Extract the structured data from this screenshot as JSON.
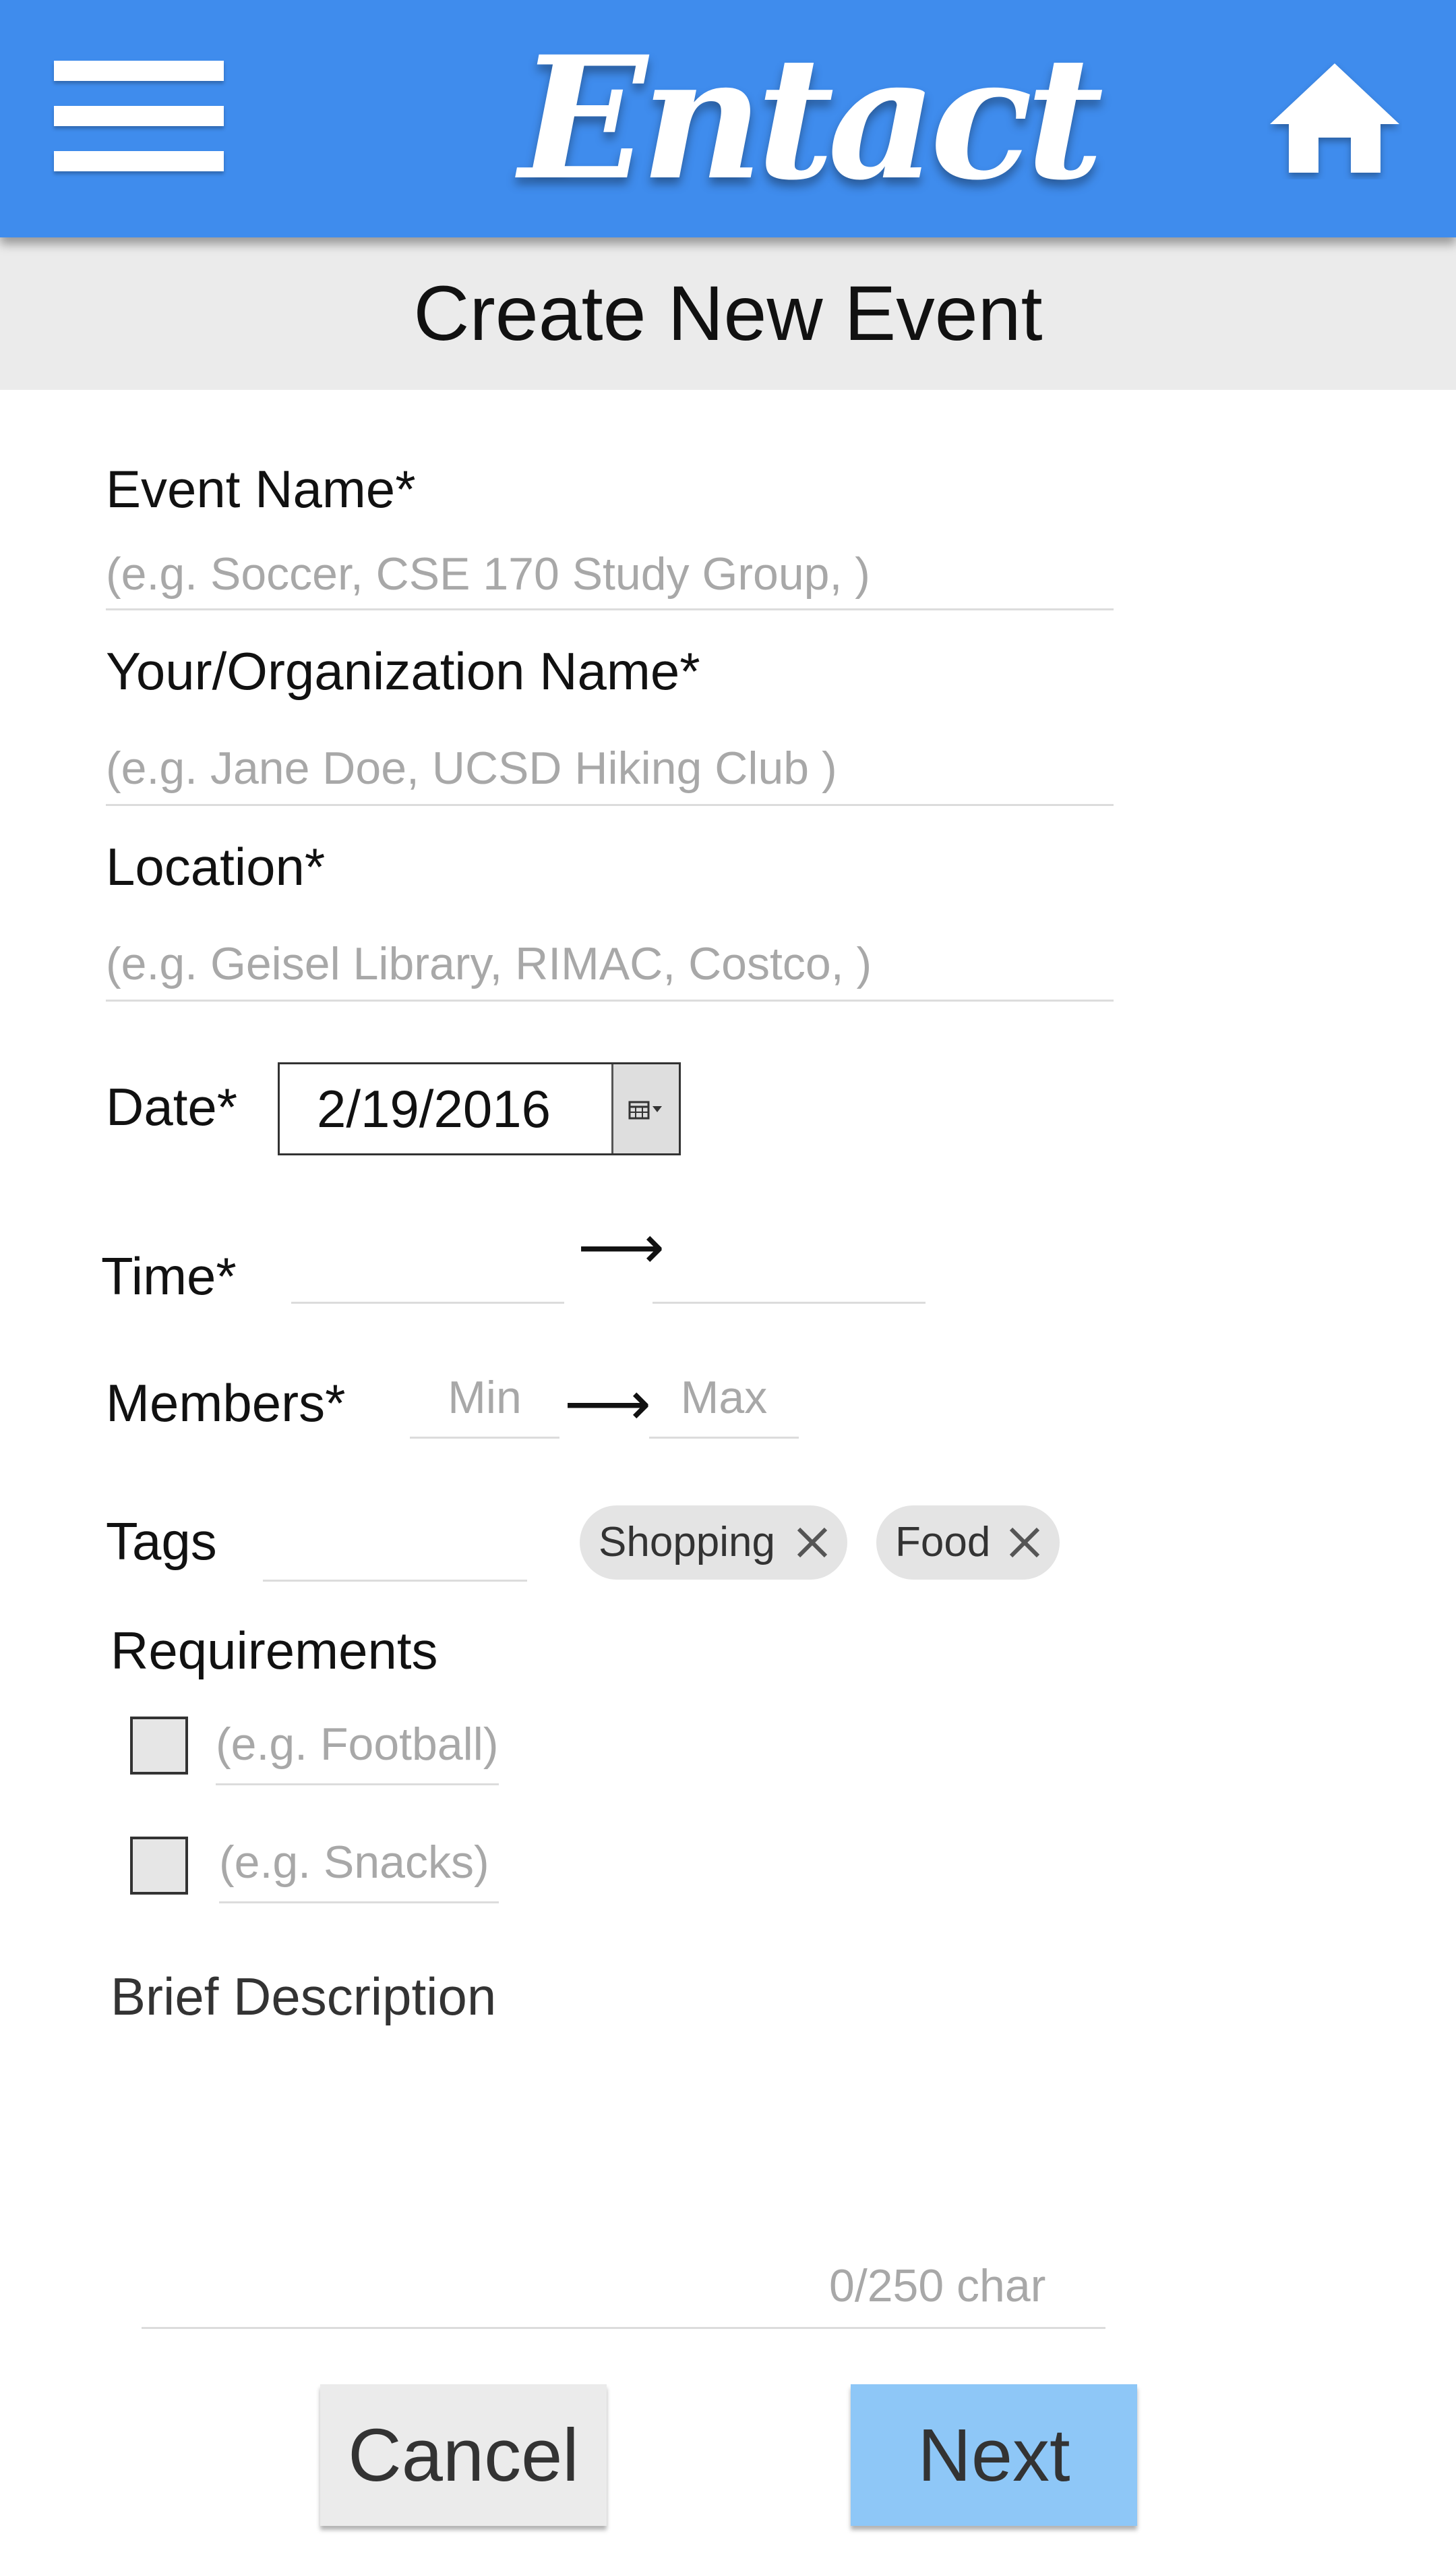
{
  "header": {
    "logo_text": "Entact",
    "menu_icon": "hamburger-menu-icon",
    "home_icon": "home-icon",
    "bar_color": "#3f8ced"
  },
  "page": {
    "title": "Create New Event"
  },
  "form": {
    "event_name": {
      "label": "Event Name*",
      "placeholder": "(e.g. Soccer, CSE 170 Study Group, )",
      "value": ""
    },
    "organizer_name": {
      "label": "Your/Organization Name*",
      "placeholder": "(e.g. Jane Doe, UCSD Hiking Club )",
      "value": ""
    },
    "location": {
      "label": "Location*",
      "placeholder": "(e.g. Geisel Library, RIMAC, Costco, )",
      "value": ""
    },
    "date": {
      "label": "Date*",
      "value": "2/19/2016",
      "picker_icon": "calendar-dropdown-icon"
    },
    "time": {
      "label": "Time*",
      "start": "",
      "end": "",
      "arrow": "⟶"
    },
    "members": {
      "label": "Members*",
      "min_placeholder": "Min",
      "max_placeholder": "Max",
      "arrow": "⟶"
    },
    "tags": {
      "label": "Tags",
      "input_value": "",
      "chips": [
        {
          "label": "Shopping",
          "remove_icon": "close-icon"
        },
        {
          "label": "Food",
          "remove_icon": "close-icon"
        }
      ]
    },
    "requirements": {
      "label": "Requirements",
      "items": [
        {
          "placeholder": "(e.g. Football)",
          "checked": false
        },
        {
          "placeholder": "(e.g. Snacks)",
          "checked": false
        }
      ]
    },
    "description": {
      "label": "Brief Description",
      "value": "",
      "char_count": "0/250 char"
    }
  },
  "actions": {
    "cancel_label": "Cancel",
    "next_label": "Next",
    "next_color": "#8ec7f7"
  }
}
